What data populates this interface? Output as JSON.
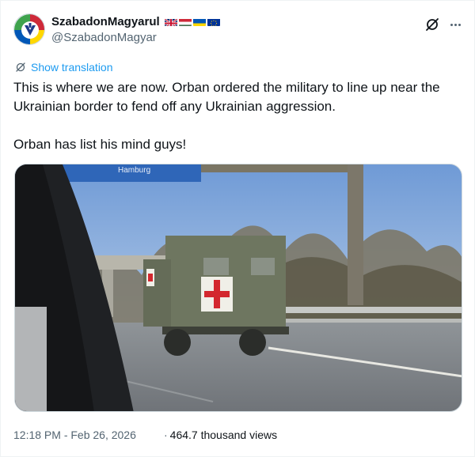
{
  "user": {
    "display_name": "SzabadonMagyarul",
    "handle": "@SzabadonMagyar"
  },
  "flags": [
    "uk-flag",
    "hungary-flag",
    "ukraine-flag",
    "eu-flag"
  ],
  "translate": {
    "label": "Show translation"
  },
  "tweet": {
    "line1": "This is where we are now. Orban ordered the military to line up near the Ukrainian border to fend off any Ukrainian aggression.",
    "line2": "Orban has list his mind guys!"
  },
  "media": {
    "kind": "video-still"
  },
  "meta": {
    "timestamp": "12:18 PM - Feb 26, 2026",
    "separator": "·",
    "views": "464.7 thousand views"
  },
  "colors": {
    "link": "#1d9bf0",
    "text": "#0f1419",
    "secondary": "#536471"
  }
}
